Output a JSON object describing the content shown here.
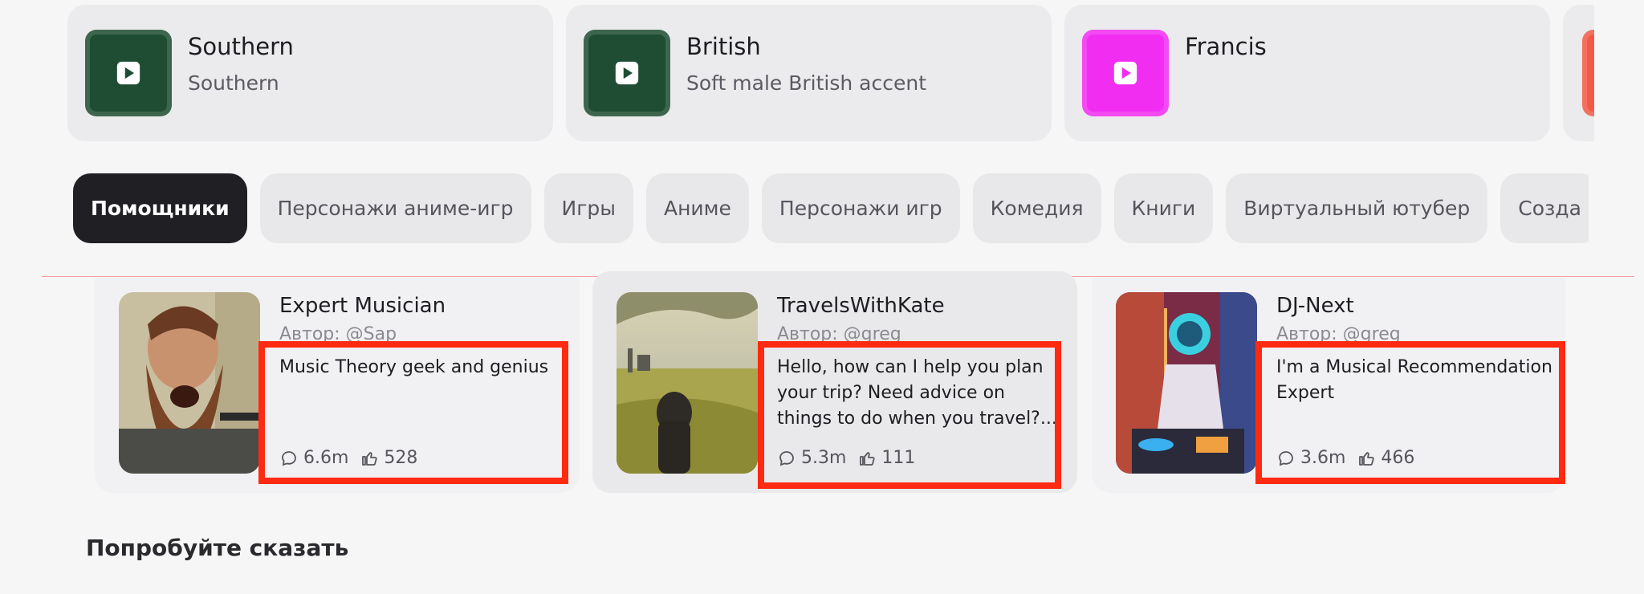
{
  "voices": [
    {
      "title": "Southern",
      "subtitle": "Southern",
      "color": "#1f4d33"
    },
    {
      "title": "British",
      "subtitle": "Soft male British accent",
      "color": "#1f4d33"
    },
    {
      "title": "Francis",
      "subtitle": "",
      "color": "#f22df2"
    },
    {
      "title": "",
      "subtitle": "",
      "color": "#f25a47"
    }
  ],
  "categories": {
    "items": [
      "Помощники",
      "Персонажи аниме-игр",
      "Игры",
      "Аниме",
      "Персонажи игр",
      "Комедия",
      "Книги",
      "Виртуальный ютубер",
      "Созда"
    ],
    "active_index": 0
  },
  "characters": [
    {
      "name": "Expert Musician",
      "author": "Автор: @Sap",
      "description": "Music Theory geek and genius",
      "chats": "6.6m",
      "likes": "528"
    },
    {
      "name": "TravelsWithKate",
      "author": "Автор: @greg",
      "description": "Hello, how can I help you plan your trip? Need advice on things to do when you travel?...",
      "chats": "5.3m",
      "likes": "111"
    },
    {
      "name": "DJ-Next",
      "author": "Автор: @greg",
      "description": "I'm a Musical Recommendation Expert",
      "chats": "3.6m",
      "likes": "466"
    }
  ],
  "section": {
    "title": "Попробуйте сказать"
  },
  "colors": {
    "highlight": "#ff2a12",
    "chip_active": "#1f1f24"
  }
}
